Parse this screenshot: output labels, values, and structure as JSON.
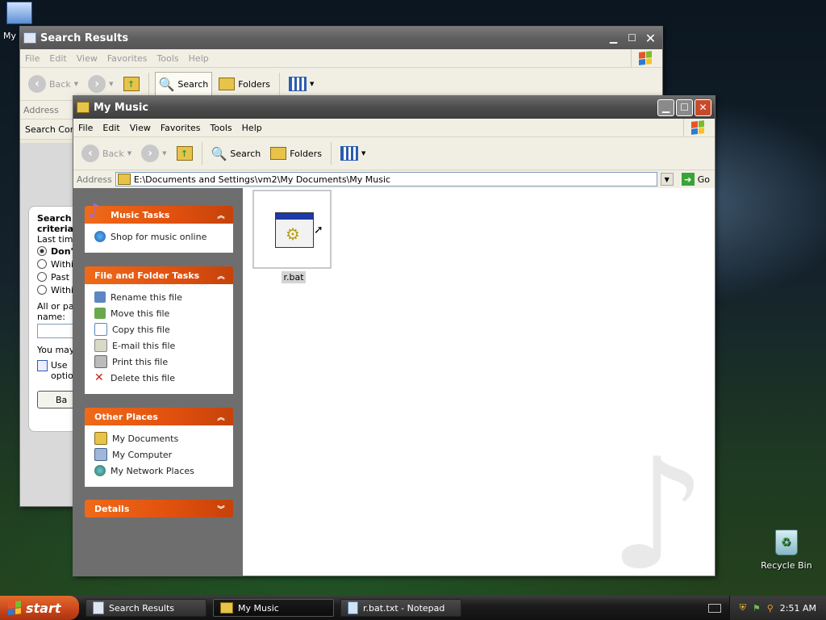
{
  "desktop": {
    "icons": [
      {
        "label": "My"
      },
      {
        "label": "Recycle Bin"
      }
    ]
  },
  "search_window": {
    "title": "Search Results",
    "menu": [
      "File",
      "Edit",
      "View",
      "Favorites",
      "Tools",
      "Help"
    ],
    "toolbar": {
      "back": "Back",
      "search": "Search",
      "folders": "Folders"
    },
    "address_label": "Address",
    "companion": "Search Com",
    "pane": {
      "heading_line1": "Search",
      "heading_line2": "criteria",
      "last_time": "Last time",
      "options": [
        "Don'",
        "Withi",
        "Past",
        "Withi"
      ],
      "name_line1": "All or par",
      "name_line2": "name:",
      "you_may": "You may",
      "use_line1": "Use",
      "use_line2": "optio",
      "back_btn": "Ba"
    }
  },
  "music_window": {
    "title": "My Music",
    "menu": [
      "File",
      "Edit",
      "View",
      "Favorites",
      "Tools",
      "Help"
    ],
    "toolbar": {
      "back": "Back",
      "search": "Search",
      "folders": "Folders"
    },
    "address_label": "Address",
    "address_value": "E:\\Documents and Settings\\vm2\\My Documents\\My Music",
    "go": "Go",
    "panels": {
      "music_tasks": {
        "title": "Music Tasks",
        "items": [
          "Shop for music online"
        ]
      },
      "file_tasks": {
        "title": "File and Folder Tasks",
        "items": [
          "Rename this file",
          "Move this file",
          "Copy this file",
          "E-mail this file",
          "Print this file",
          "Delete this file"
        ]
      },
      "other_places": {
        "title": "Other Places",
        "items": [
          "My Documents",
          "My Computer",
          "My Network Places"
        ]
      },
      "details": {
        "title": "Details"
      }
    },
    "files": [
      {
        "name": "r.bat",
        "icon": "batch-file-icon"
      }
    ]
  },
  "taskbar": {
    "start": "start",
    "tasks": [
      {
        "label": "Search Results"
      },
      {
        "label": "My Music"
      },
      {
        "label": "r.bat.txt - Notepad"
      }
    ],
    "clock": "2:51 AM"
  },
  "colors": {
    "panel_header": "#e0500e",
    "start": "#c9441b",
    "content_bg": "#ffffff"
  }
}
